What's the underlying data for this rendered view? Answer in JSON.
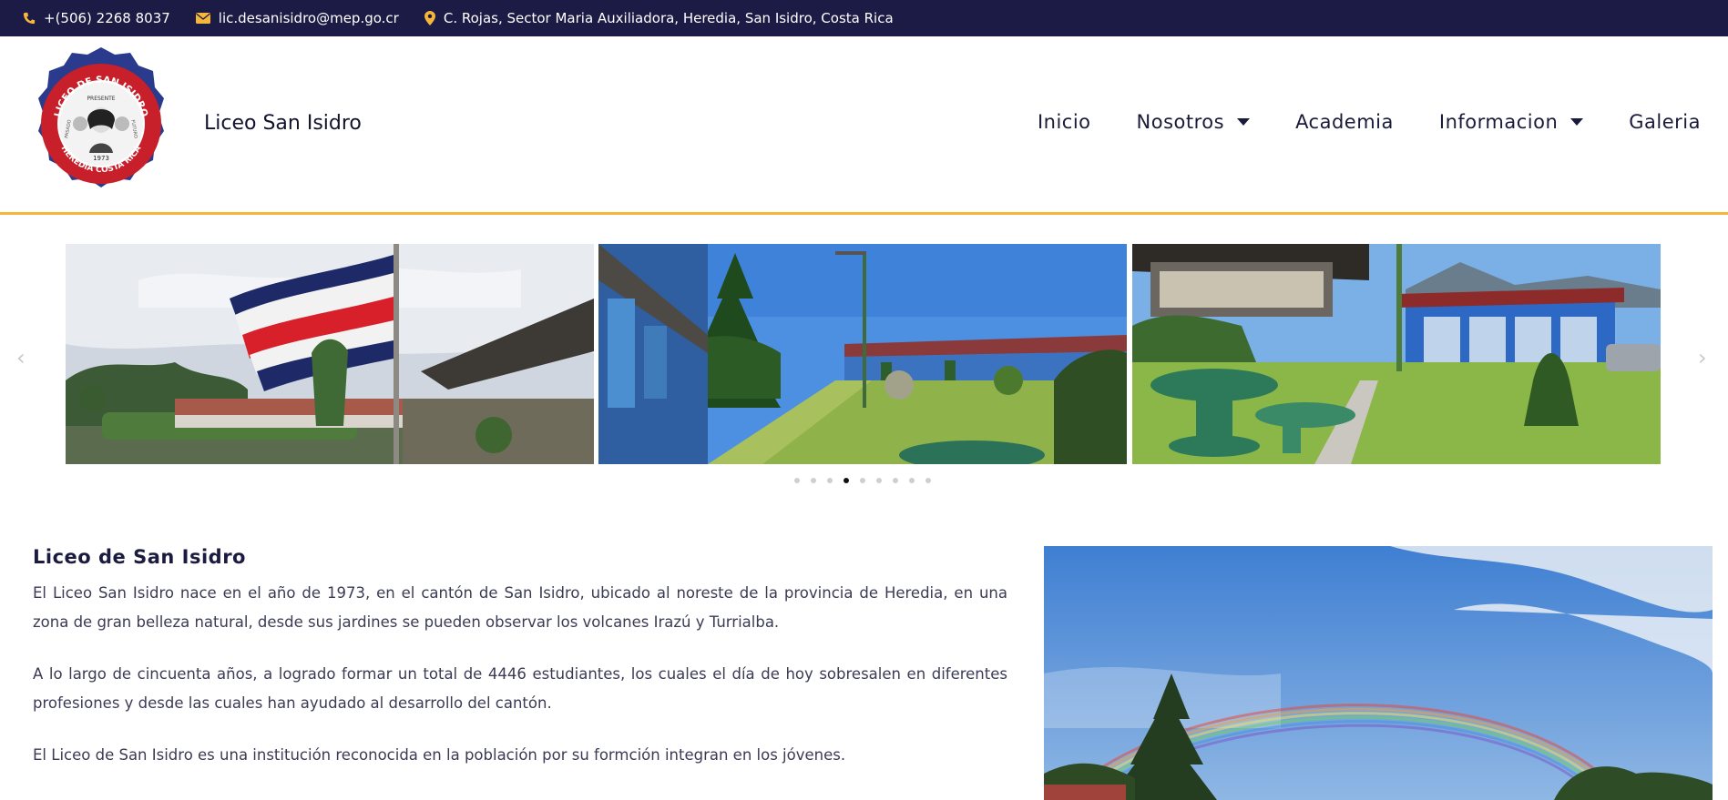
{
  "topbar": {
    "phone": "+(506) 2268 8037",
    "email": "lic.desanisidro@mep.go.cr",
    "address": "C. Rojas, Sector Maria Auxiliadora, Heredia, San Isidro, Costa Rica"
  },
  "header": {
    "site_title": "Liceo San Isidro",
    "logo": {
      "top_text": "LICEO DE SAN ISIDRO",
      "inner_text": "PRESENTE",
      "left_text": "PASADO",
      "right_text": "FUTURO",
      "year": "1973",
      "bottom_text": "HEREDIA COSTA RICA"
    }
  },
  "nav": {
    "items": [
      {
        "label": "Inicio",
        "dropdown": false
      },
      {
        "label": "Nosotros",
        "dropdown": true
      },
      {
        "label": "Academia",
        "dropdown": false
      },
      {
        "label": "Informacion",
        "dropdown": true
      },
      {
        "label": "Galeria",
        "dropdown": false
      }
    ]
  },
  "carousel": {
    "prev_icon": "chevron-left-icon",
    "next_icon": "chevron-right-icon",
    "dot_count": 9,
    "active_dot": 4
  },
  "about": {
    "heading": "Liceo de San Isidro",
    "paragraphs": [
      "El Liceo San Isidro nace en el año de 1973, en el cantón de San Isidro, ubicado al noreste de la provincia de Heredia, en una zona de gran belleza natural, desde sus jardines se pueden observar los volcanes Irazú y Turrialba.",
      "A lo largo de cincuenta años, a logrado formar un total de 4446 estudiantes, los cuales el día de hoy sobresalen en diferentes profesiones y desde las cuales han ayudado al desarrollo del cantón.",
      "El Liceo de San Isidro es una institución reconocida en la población por su formción integran en los jóvenes."
    ]
  },
  "colors": {
    "topbar_bg": "#1b1b45",
    "accent": "#f5b73a",
    "heading": "#1b1b3f"
  }
}
